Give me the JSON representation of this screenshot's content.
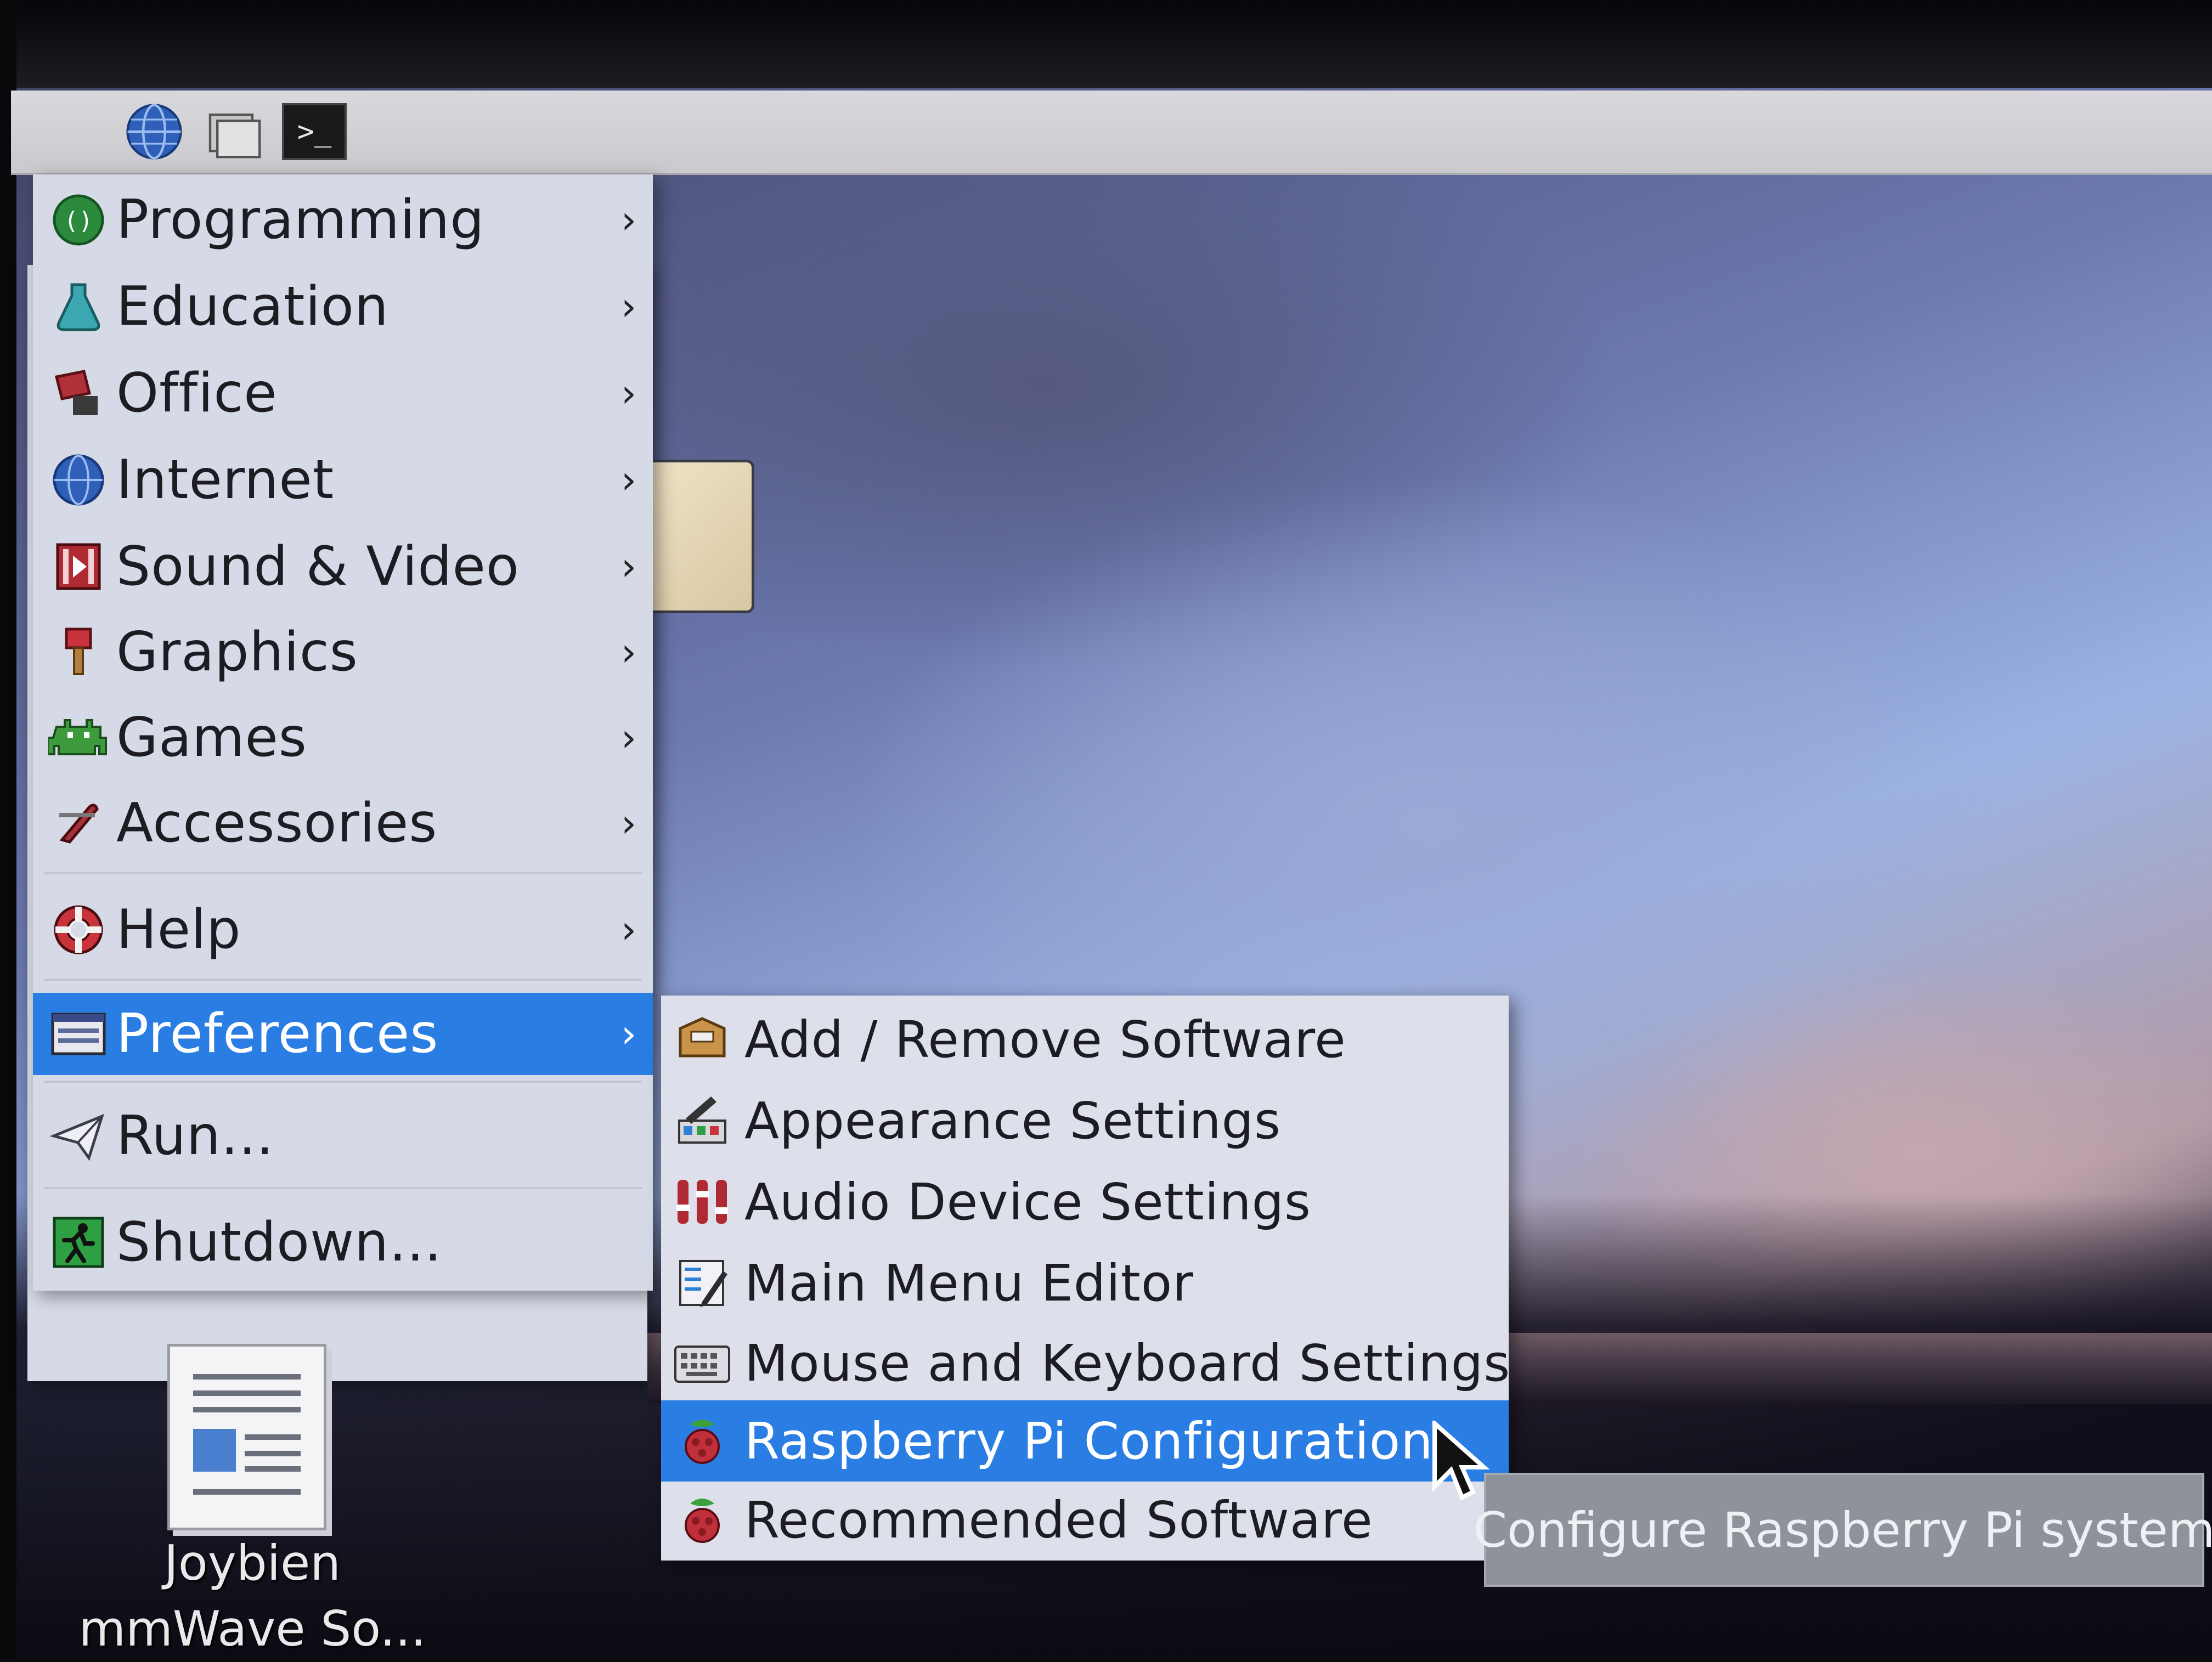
{
  "taskbar": {
    "buttons": [
      {
        "name": "menu",
        "icon": "raspberry-icon"
      },
      {
        "name": "web-browser",
        "icon": "globe-icon"
      },
      {
        "name": "file-manager",
        "icon": "folder-icon"
      },
      {
        "name": "terminal",
        "icon": "terminal-icon",
        "label": ">_"
      }
    ]
  },
  "menu": {
    "items": [
      {
        "label": "Programming",
        "icon": "programming-icon",
        "has_submenu": true
      },
      {
        "label": "Education",
        "icon": "education-icon",
        "has_submenu": true
      },
      {
        "label": "Office",
        "icon": "office-icon",
        "has_submenu": true
      },
      {
        "label": "Internet",
        "icon": "globe-icon",
        "has_submenu": true
      },
      {
        "label": "Sound & Video",
        "icon": "sound-video-icon",
        "has_submenu": true
      },
      {
        "label": "Graphics",
        "icon": "graphics-icon",
        "has_submenu": true
      },
      {
        "label": "Games",
        "icon": "games-icon",
        "has_submenu": true
      },
      {
        "label": "Accessories",
        "icon": "accessories-icon",
        "has_submenu": true
      },
      {
        "label": "Help",
        "icon": "help-icon",
        "has_submenu": true
      },
      {
        "label": "Preferences",
        "icon": "preferences-icon",
        "has_submenu": true,
        "active": true
      },
      {
        "label": "Run...",
        "icon": "run-icon",
        "has_submenu": false
      },
      {
        "label": "Shutdown...",
        "icon": "shutdown-icon",
        "has_submenu": false
      }
    ],
    "arrow": "›"
  },
  "submenu": {
    "items": [
      {
        "label": "Add / Remove Software",
        "icon": "package-icon"
      },
      {
        "label": "Appearance Settings",
        "icon": "appearance-icon"
      },
      {
        "label": "Audio Device Settings",
        "icon": "audio-mixer-icon"
      },
      {
        "label": "Main Menu Editor",
        "icon": "menu-editor-icon"
      },
      {
        "label": "Mouse and Keyboard Settings",
        "icon": "keyboard-icon"
      },
      {
        "label": "Raspberry Pi Configuration",
        "icon": "raspberry-icon",
        "active": true
      },
      {
        "label": "Recommended Software",
        "icon": "raspberry-icon"
      }
    ]
  },
  "tooltip": {
    "text": "Configure Raspberry Pi system"
  },
  "desktop": {
    "file_icon": {
      "label_line1": "Joybien",
      "label_line2": "mmWave So..."
    }
  },
  "colors": {
    "highlight": "#2a7ee3",
    "menu_bg": "#d6dae6",
    "taskbar_bg": "#d9d9dd"
  }
}
